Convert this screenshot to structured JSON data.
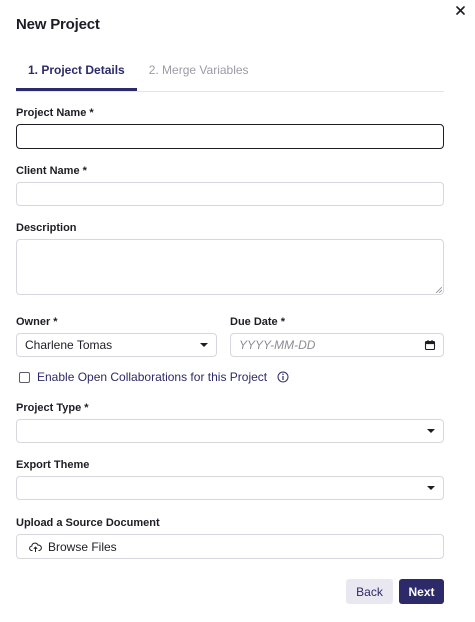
{
  "dialog": {
    "title": "New Project",
    "close_icon": "close-icon"
  },
  "tabs": [
    {
      "label": "1. Project Details",
      "active": true
    },
    {
      "label": "2. Merge Variables",
      "active": false
    }
  ],
  "form": {
    "project_name": {
      "label": "Project Name *",
      "value": ""
    },
    "client_name": {
      "label": "Client Name *",
      "value": ""
    },
    "description": {
      "label": "Description",
      "value": ""
    },
    "owner": {
      "label": "Owner *",
      "value": "Charlene Tomas"
    },
    "due_date": {
      "label": "Due Date *",
      "placeholder": "YYYY-MM-DD",
      "value": ""
    },
    "open_collab": {
      "label": "Enable Open Collaborations for this Project",
      "checked": false
    },
    "project_type": {
      "label": "Project Type *",
      "value": ""
    },
    "export_theme": {
      "label": "Export Theme",
      "value": ""
    },
    "upload": {
      "label": "Upload a Source Document",
      "button_label": "Browse Files"
    }
  },
  "actions": {
    "back_label": "Back",
    "next_label": "Next"
  },
  "colors": {
    "primary": "#2c2a68",
    "secondary_bg": "#e9e8f1",
    "border": "#d7d7dd",
    "muted_text": "#9b9ba6"
  }
}
